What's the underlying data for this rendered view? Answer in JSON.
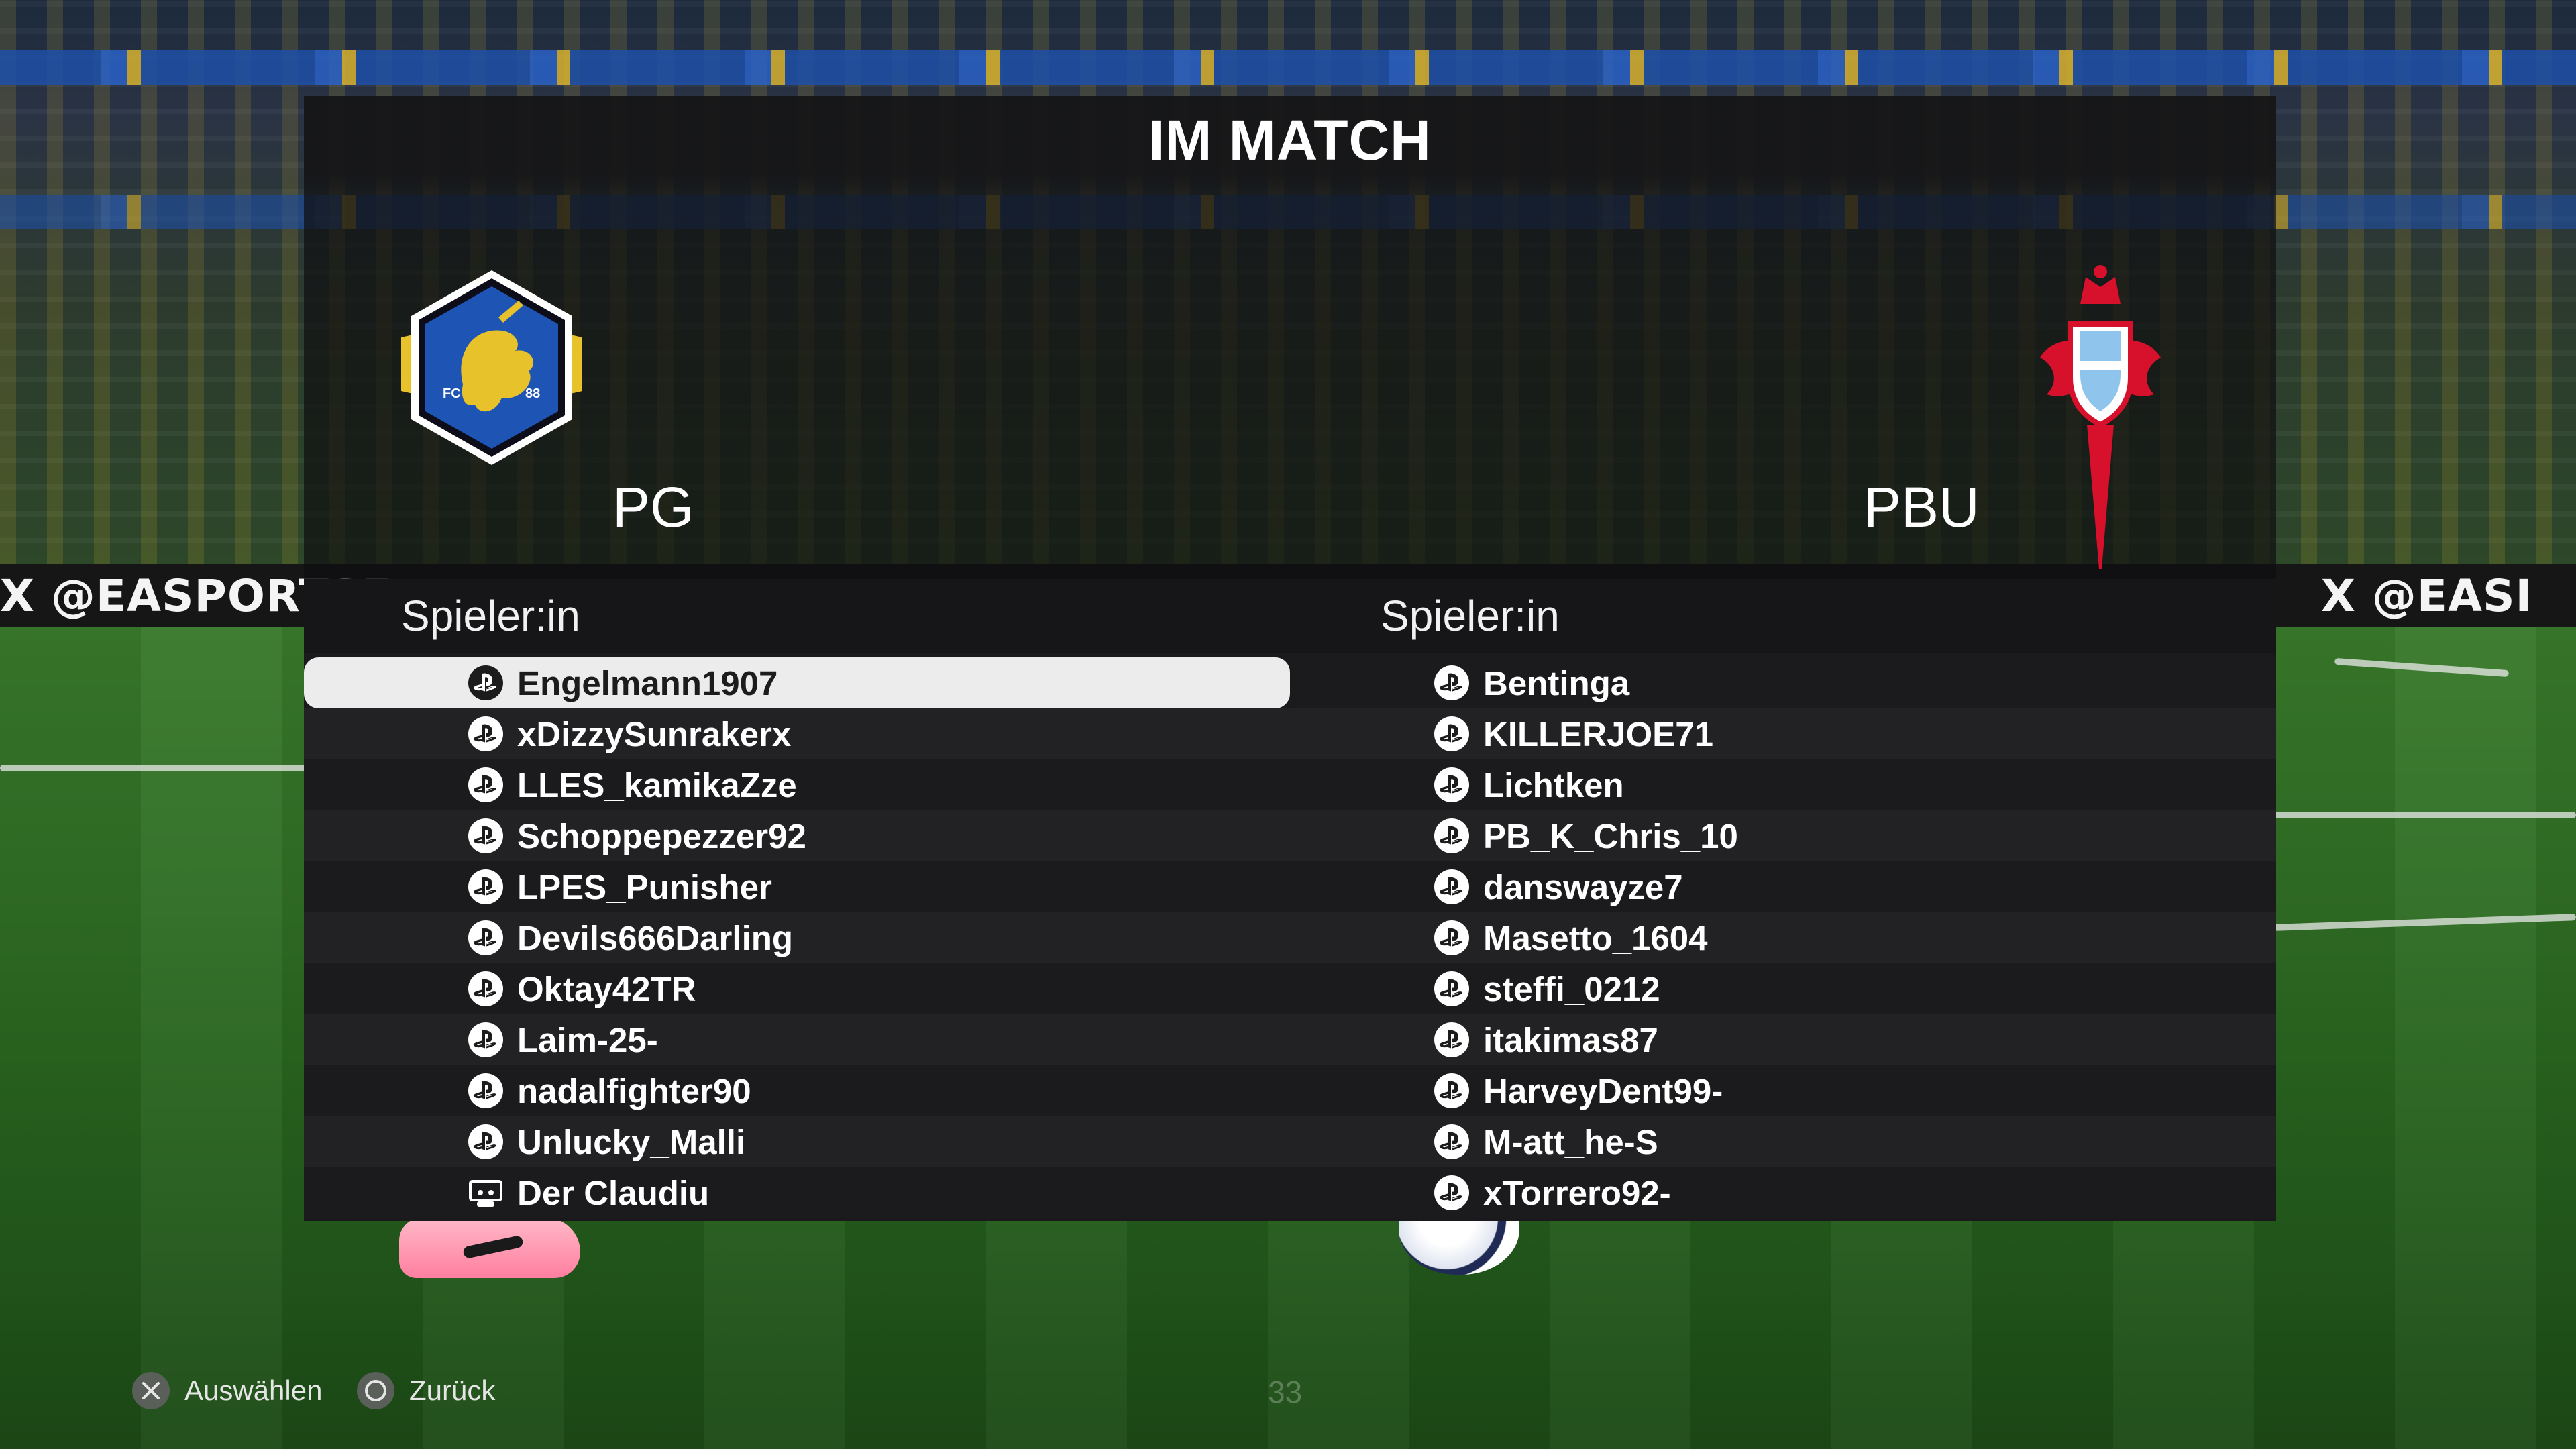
{
  "title": "IM MATCH",
  "home_team": {
    "abbr": "PG",
    "badge_text_left": "FC",
    "badge_text_right": "88",
    "column_label": "Spieler:in",
    "players": [
      {
        "name": "Engelmann1907",
        "platform": "playstation",
        "selected": true
      },
      {
        "name": "xDizzySunrakerx",
        "platform": "playstation"
      },
      {
        "name": "LLES_kamikaZze",
        "platform": "playstation"
      },
      {
        "name": "Schoppepezzer92",
        "platform": "playstation"
      },
      {
        "name": "LPES_Punisher",
        "platform": "playstation"
      },
      {
        "name": "Devils666Darling",
        "platform": "playstation"
      },
      {
        "name": "Oktay42TR",
        "platform": "playstation"
      },
      {
        "name": "Laim-25-",
        "platform": "playstation"
      },
      {
        "name": "nadalfighter90",
        "platform": "playstation"
      },
      {
        "name": "Unlucky_Malli",
        "platform": "playstation"
      },
      {
        "name": "Der Claudiu",
        "platform": "cpu"
      }
    ]
  },
  "away_team": {
    "abbr": "PBU",
    "column_label": "Spieler:in",
    "players": [
      {
        "name": "Bentinga",
        "platform": "playstation"
      },
      {
        "name": "KILLERJOE71",
        "platform": "playstation"
      },
      {
        "name": "Lichtken",
        "platform": "playstation"
      },
      {
        "name": "PB_K_Chris_10",
        "platform": "playstation"
      },
      {
        "name": "danswayze7",
        "platform": "playstation"
      },
      {
        "name": "Masetto_1604",
        "platform": "playstation"
      },
      {
        "name": "steffi_0212",
        "platform": "playstation"
      },
      {
        "name": "itakimas87",
        "platform": "playstation"
      },
      {
        "name": "HarveyDent99-",
        "platform": "playstation"
      },
      {
        "name": "M-att_he-S",
        "platform": "playstation"
      },
      {
        "name": "xTorrero92-",
        "platform": "playstation"
      }
    ]
  },
  "footer": {
    "select_label": "Auswählen",
    "select_icon": "cross-button-icon",
    "back_label": "Zurück",
    "back_icon": "circle-button-icon",
    "page_number": "33"
  },
  "background": {
    "ad_text_left": "X @EASPORTSF",
    "ad_text_right": "X @EASI"
  },
  "colors": {
    "selected_row": "#ececec",
    "panel": "#1a1a1c",
    "home_badge_blue": "#1e54b4",
    "home_badge_gold": "#e8c22a",
    "away_badge_red": "#d7102c",
    "away_badge_blue": "#8fc4ec"
  }
}
